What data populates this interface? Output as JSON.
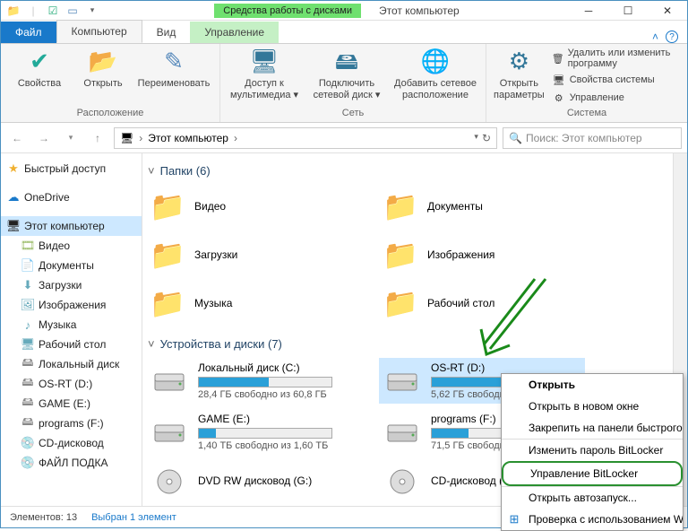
{
  "title": "Этот компьютер",
  "contextual_label": "Средства работы с дисками",
  "ribbon_tabs": {
    "file": "Файл",
    "computer": "Компьютер",
    "view": "Вид",
    "manage": "Управление"
  },
  "ribbon": {
    "group_location": "Расположение",
    "group_network": "Сеть",
    "group_system": "Система",
    "props": "Свойства",
    "open": "Открыть",
    "rename": "Переименовать",
    "media_access": "Доступ к мультимедиа ▾",
    "map_drive": "Подключить сетевой диск ▾",
    "add_netloc": "Добавить сетевое расположение",
    "open_params": "Открыть параметры",
    "sys_uninstall": "Удалить или изменить программу",
    "sys_props": "Свойства системы",
    "sys_manage": "Управление"
  },
  "nav": {
    "breadcrumb_root": "Этот компьютер",
    "search_placeholder": "Поиск: Этот компьютер"
  },
  "tree": {
    "quick": "Быстрый доступ",
    "onedrive": "OneDrive",
    "thispc": "Этот компьютер",
    "video": "Видео",
    "documents": "Документы",
    "downloads": "Загрузки",
    "pictures": "Изображения",
    "music": "Музыка",
    "desktop": "Рабочий стол",
    "local": "Локальный диск",
    "osrt": "OS-RT (D:)",
    "game": "GAME (E:)",
    "programs": "programs (F:)",
    "cd": "CD-дисковод",
    "file_sub": "ФАЙЛ ПОДКА"
  },
  "sections": {
    "folders": "Папки (6)",
    "drives": "Устройства и диски (7)"
  },
  "folders": {
    "video": "Видео",
    "documents": "Документы",
    "downloads": "Загрузки",
    "pictures": "Изображения",
    "music": "Музыка",
    "desktop": "Рабочий стол"
  },
  "drives": [
    {
      "name": "Локальный диск (C:)",
      "free": "28,4 ГБ свободно из 60,8 ГБ",
      "fill": 53
    },
    {
      "name": "OS-RT (D:)",
      "free": "5,62 ГБ свободн",
      "fill": 70
    },
    {
      "name": "GAME (E:)",
      "free": "1,40 ТБ свободно из 1,60 ТБ",
      "fill": 13
    },
    {
      "name": "programs (F:)",
      "free": "71,5 ГБ свободно",
      "fill": 28
    },
    {
      "name": "DVD RW дисковод (G:)",
      "free": "",
      "fill": 0
    },
    {
      "name": "CD-дисковод (H:)",
      "free": "",
      "fill": 0
    }
  ],
  "context_menu": {
    "open": "Открыть",
    "open_new": "Открыть в новом окне",
    "pin_quick": "Закрепить на панели быстрого доступа",
    "change_pw": "Изменить пароль BitLocker",
    "manage_bl": "Управление BitLocker",
    "autoplay": "Открыть автозапуск...",
    "defender": "Проверка с использованием Windows"
  },
  "status": {
    "count": "Элементов: 13",
    "selected": "Выбран 1 элемент"
  }
}
